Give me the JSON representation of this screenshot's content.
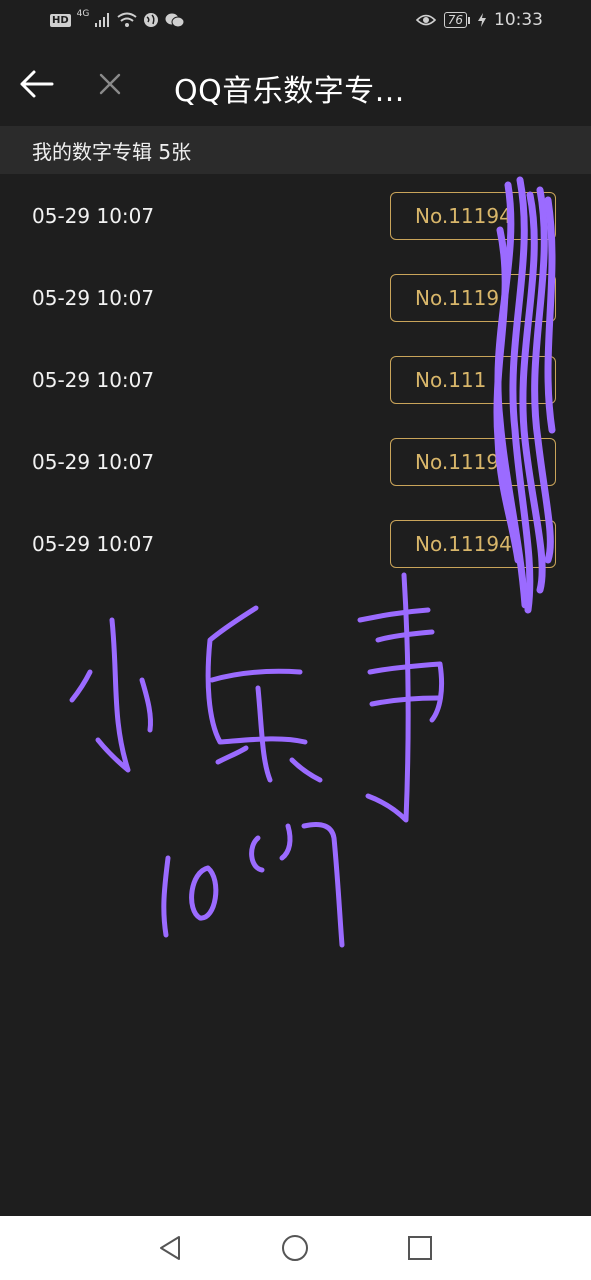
{
  "status_bar": {
    "network_badge": "HD",
    "network_type": "4G",
    "battery": "76",
    "time": "10:33"
  },
  "app_bar": {
    "title": "QQ音乐数字专..."
  },
  "section_header": "我的数字专辑 5张",
  "albums": [
    {
      "date": "05-29 10:07",
      "number": "No.11194"
    },
    {
      "date": "05-29 10:07",
      "number": "No.1119"
    },
    {
      "date": "05-29 10:07",
      "number": "No.111"
    },
    {
      "date": "05-29 10:07",
      "number": "No.1119"
    },
    {
      "date": "05-29 10:07",
      "number": "No.11194"
    }
  ],
  "overlay": {
    "color": "#9b6bff",
    "handwriting_line1": "小乐事",
    "handwriting_line2": "1007"
  },
  "colors": {
    "background": "#1e1e1e",
    "header_bg": "#2b2b2b",
    "accent_gold": "#c9a45a"
  }
}
